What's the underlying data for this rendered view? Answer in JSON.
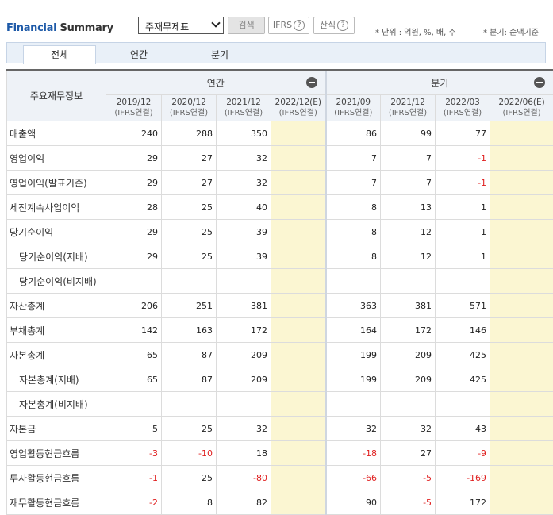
{
  "header": {
    "title_part1": "Financial",
    "title_part2": " Summary",
    "select_value": "주재무제표",
    "search_label": "검색",
    "ifrs_label": "IFRS",
    "calc_label": "산식",
    "help_glyph": "?",
    "unit_note": "* 단위 : 억원, %, 배, 주",
    "period_note": "* 분기: 순액기준"
  },
  "tabs": [
    "전체",
    "연간",
    "분기"
  ],
  "table": {
    "row_header_label": "주요재무정보",
    "annual_group": "연간",
    "quarter_group": "분기",
    "periods": [
      {
        "date": "2019/12",
        "basis": "(IFRS연결)"
      },
      {
        "date": "2020/12",
        "basis": "(IFRS연결)"
      },
      {
        "date": "2021/12",
        "basis": "(IFRS연결)"
      },
      {
        "date": "2022/12(E)",
        "basis": "(IFRS연결)"
      },
      {
        "date": "2021/09",
        "basis": "(IFRS연결)"
      },
      {
        "date": "2021/12",
        "basis": "(IFRS연결)"
      },
      {
        "date": "2022/03",
        "basis": "(IFRS연결)"
      },
      {
        "date": "2022/06(E)",
        "basis": "(IFRS연결)"
      }
    ],
    "rows": [
      {
        "label": "매출액",
        "values": [
          "240",
          "288",
          "350",
          "",
          "86",
          "99",
          "77",
          ""
        ]
      },
      {
        "label": "영업이익",
        "values": [
          "29",
          "27",
          "32",
          "",
          "7",
          "7",
          "-1",
          ""
        ]
      },
      {
        "label": "영업이익(발표기준)",
        "values": [
          "29",
          "27",
          "32",
          "",
          "7",
          "7",
          "-1",
          ""
        ]
      },
      {
        "label": "세전계속사업이익",
        "values": [
          "28",
          "25",
          "40",
          "",
          "8",
          "13",
          "1",
          ""
        ]
      },
      {
        "label": "당기순이익",
        "values": [
          "29",
          "25",
          "39",
          "",
          "8",
          "12",
          "1",
          ""
        ]
      },
      {
        "label": "당기순이익(지배)",
        "values": [
          "29",
          "25",
          "39",
          "",
          "8",
          "12",
          "1",
          ""
        ]
      },
      {
        "label": "당기순이익(비지배)",
        "values": [
          "",
          "",
          "",
          "",
          "",
          "",
          "",
          ""
        ]
      },
      {
        "label": "자산총계",
        "values": [
          "206",
          "251",
          "381",
          "",
          "363",
          "381",
          "571",
          ""
        ]
      },
      {
        "label": "부채총계",
        "values": [
          "142",
          "163",
          "172",
          "",
          "164",
          "172",
          "146",
          ""
        ]
      },
      {
        "label": "자본총계",
        "values": [
          "65",
          "87",
          "209",
          "",
          "199",
          "209",
          "425",
          ""
        ]
      },
      {
        "label": "자본총계(지배)",
        "values": [
          "65",
          "87",
          "209",
          "",
          "199",
          "209",
          "425",
          ""
        ]
      },
      {
        "label": "자본총계(비지배)",
        "values": [
          "",
          "",
          "",
          "",
          "",
          "",
          "",
          ""
        ]
      },
      {
        "label": "자본금",
        "values": [
          "5",
          "25",
          "32",
          "",
          "32",
          "32",
          "43",
          ""
        ]
      },
      {
        "label": "영업활동현금흐름",
        "values": [
          "-3",
          "-10",
          "18",
          "",
          "-18",
          "27",
          "-9",
          ""
        ]
      },
      {
        "label": "투자활동현금흐름",
        "values": [
          "-1",
          "25",
          "-80",
          "",
          "-66",
          "-5",
          "-169",
          ""
        ]
      },
      {
        "label": "재무활동현금흐름",
        "values": [
          "-2",
          "8",
          "82",
          "",
          "90",
          "-5",
          "172",
          ""
        ]
      }
    ],
    "indented_rows": [
      5,
      6,
      10,
      11
    ]
  },
  "colors": {
    "accent": "#1e5aa8",
    "estimate_bg": "#fbf6d2",
    "negative": "#e02020",
    "header_bg": "#eef2f7"
  }
}
